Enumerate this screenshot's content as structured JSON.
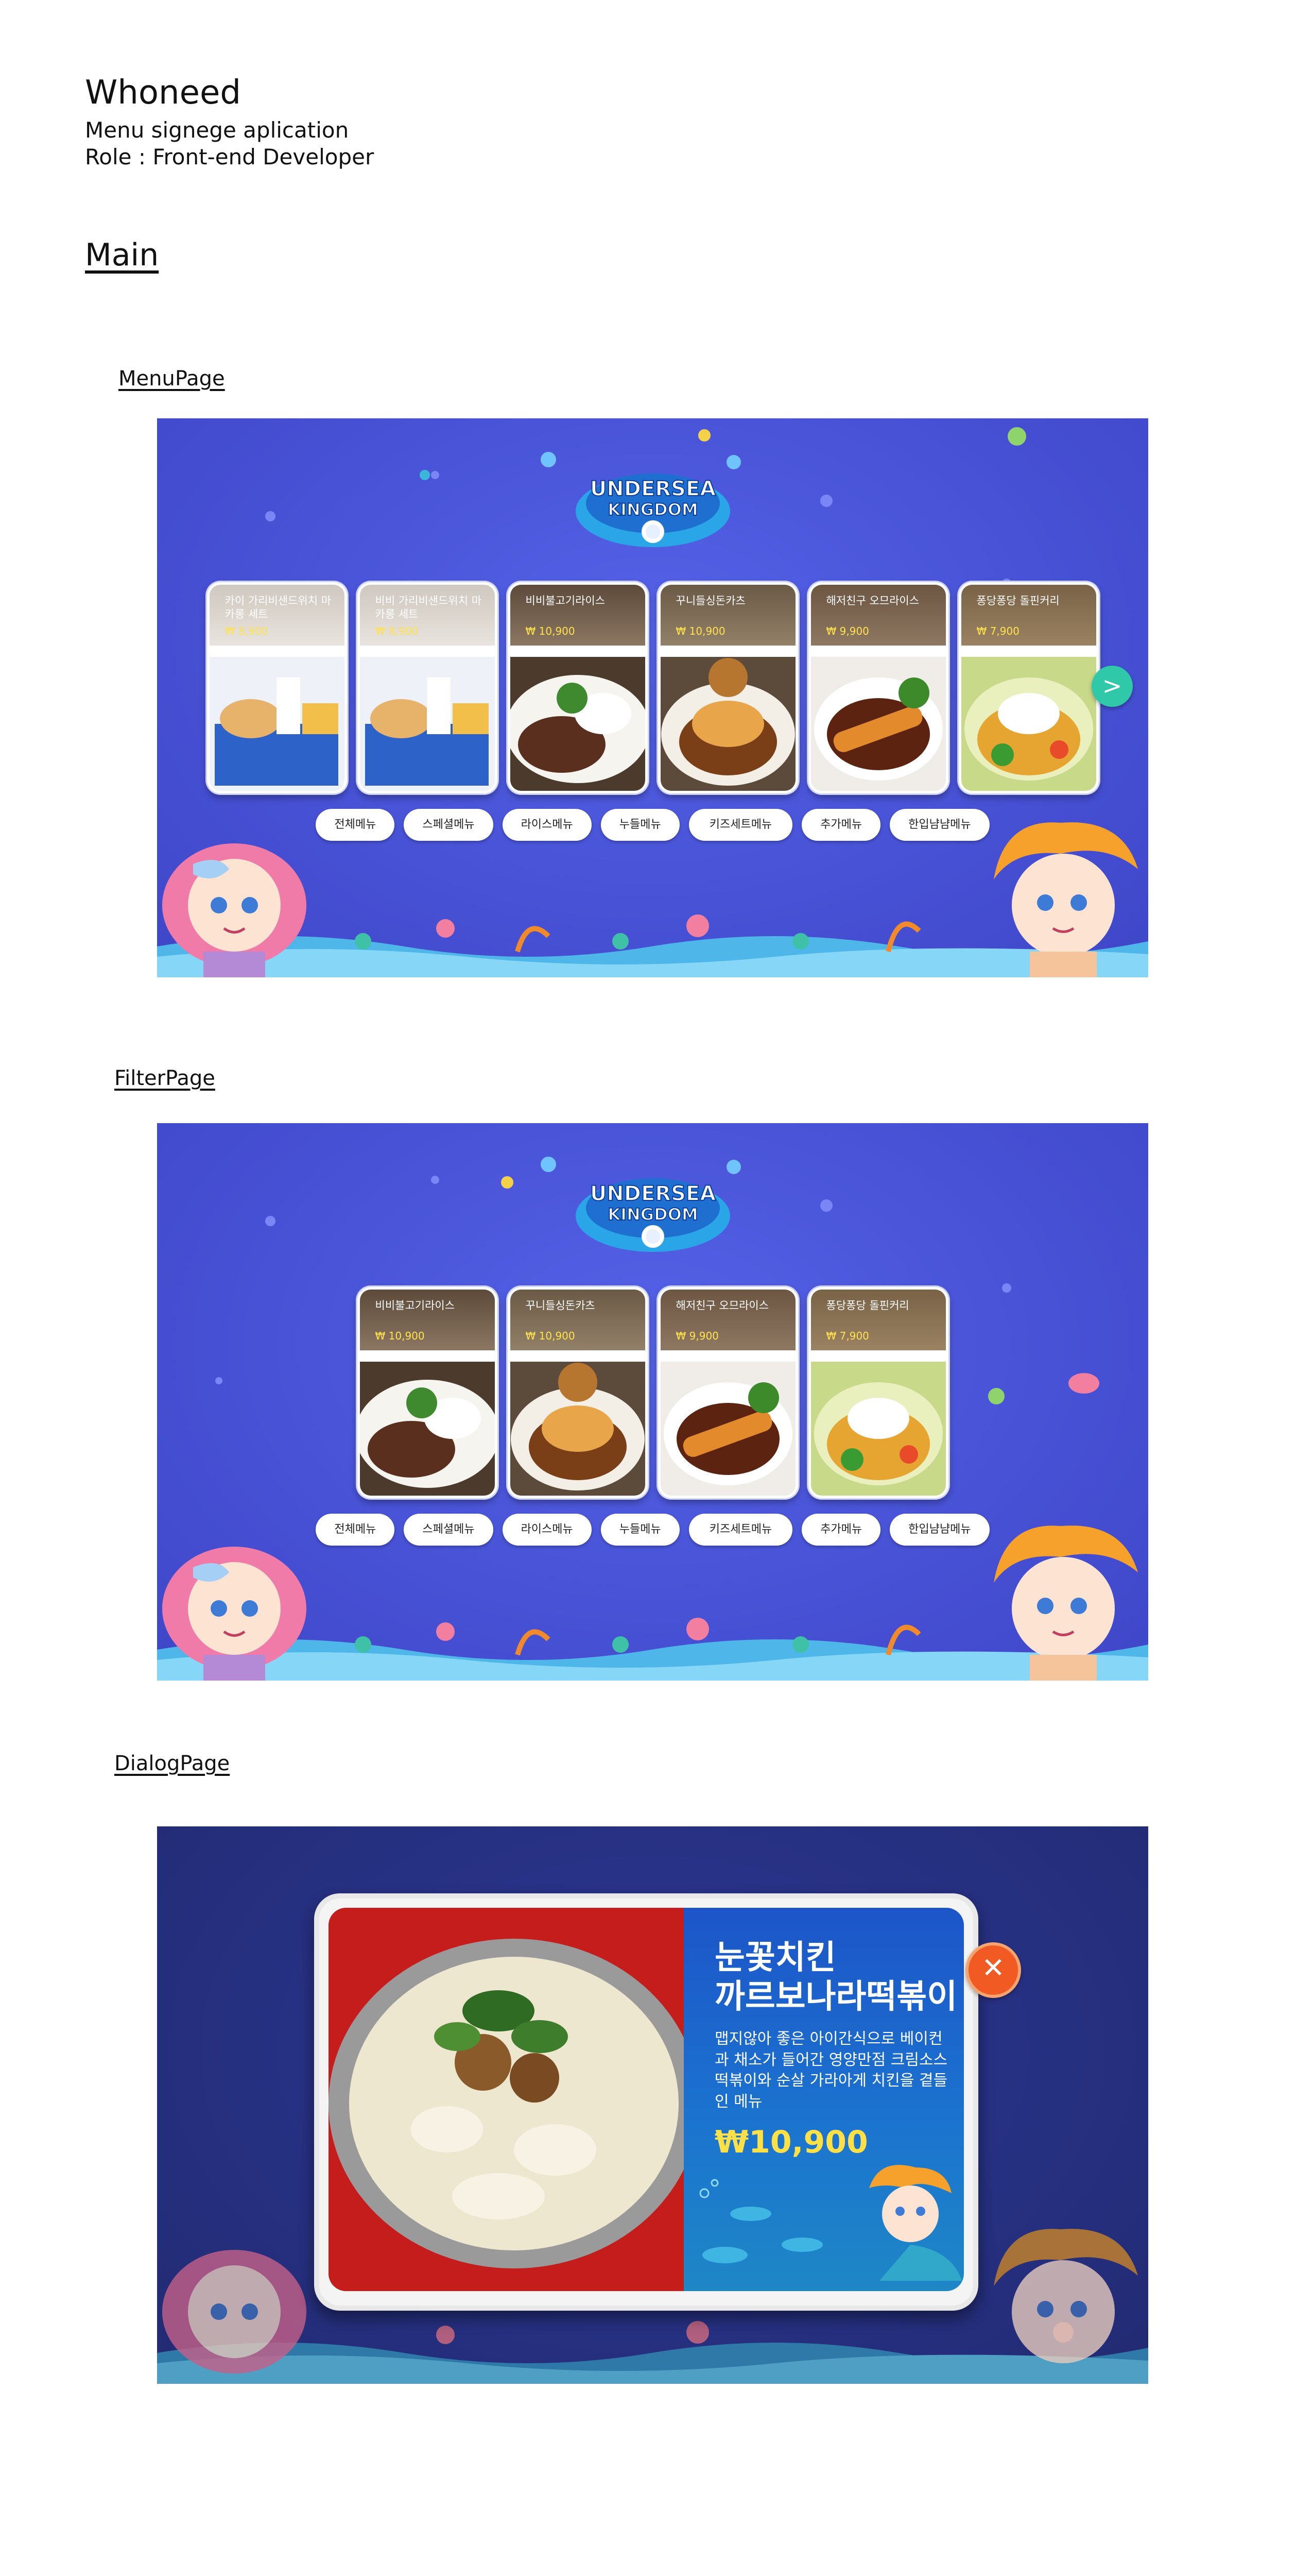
{
  "header": {
    "title": "Whoneed",
    "subtitle": "Menu signege aplication",
    "role": "Role : Front-end Developer",
    "section": "Main"
  },
  "pages": {
    "menu_label": "MenuPage",
    "filter_label": "FilterPage",
    "dialog_label": "DialogPage"
  },
  "menu_page": {
    "cards": [
      {
        "name": "카이 가리비샌드위치 마카롱 세트",
        "price": "₩ 8,900"
      },
      {
        "name": "비비 가리비샌드위치 마카롱 세트",
        "price": "₩ 8,900"
      },
      {
        "name": "비비불고기라이스",
        "price": "₩ 10,900"
      },
      {
        "name": "꾸니들싱돈카츠",
        "price": "₩ 10,900"
      },
      {
        "name": "해저친구 오므라이스",
        "price": "₩ 9,900"
      },
      {
        "name": "퐁당퐁당 돌핀커리",
        "price": "₩ 7,900"
      }
    ],
    "next_icon": ">"
  },
  "filter_page": {
    "cards": [
      {
        "name": "비비불고기라이스",
        "price": "₩ 10,900"
      },
      {
        "name": "꾸니들싱돈카츠",
        "price": "₩ 10,900"
      },
      {
        "name": "해저친구 오므라이스",
        "price": "₩ 9,900"
      },
      {
        "name": "퐁당퐁당 돌핀커리",
        "price": "₩ 7,900"
      }
    ]
  },
  "categories": [
    "전체메뉴",
    "스페셜메뉴",
    "라이스메뉴",
    "누들메뉴",
    "키즈세트메뉴",
    "추가메뉴",
    "한입냠냠메뉴"
  ],
  "dialog_page": {
    "title_line1": "눈꽃치킨",
    "title_line2": "까르보나라떡볶이",
    "description": "맵지않아 좋은 아이간식으로 베이컨과 채소가 들어간 영양만점 크림소스 떡볶이와 순살 가라아게 치킨을 곁들인 메뉴",
    "price": "₩10,900",
    "close_icon": "✕"
  },
  "colors": {
    "screen_bg": "#4a55d9",
    "next_button": "#2fc8a8",
    "close_button": "#f15a22",
    "price_yellow": "#ffe34b"
  }
}
